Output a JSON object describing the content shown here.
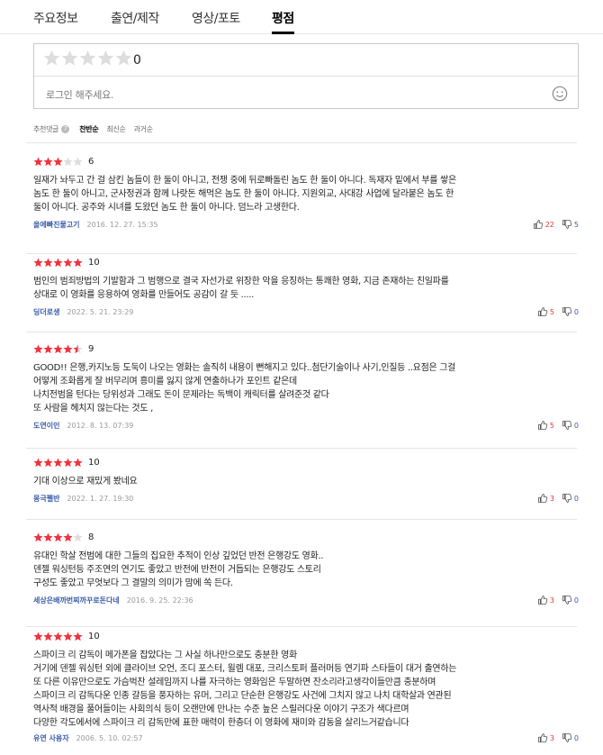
{
  "tabs": [
    {
      "label": "주요정보"
    },
    {
      "label": "출연/제작"
    },
    {
      "label": "영상/포토"
    },
    {
      "label": "평점"
    }
  ],
  "rating_box": {
    "score": "0",
    "placeholder": "로그인 해주세요."
  },
  "sort": {
    "label": "추천댓글",
    "help_icon": "?",
    "options": [
      "찬반순",
      "최신순",
      "과거순"
    ]
  },
  "reviews": [
    {
      "rating": 6,
      "text": "일재가 놔두고 간 걸 삼킨 놈들이 한 둘이 아니고, 전쟁 중에 뒤로빠돌린 놈도 한 둘이 아니다. 독재자 밑에서 부를 쌓은\n놈도 한 둘이 아니고, 군사정권과 함께 나랏돈 해먹은 놈도 한 둘이 아니다. 지원외교, 사대강 사업에 달라붙은 놈도 한\n둘이 아니다. 공주와 시녀를 도왔던 놈도 한 둘이 아니다. 덤느라 고생한다.",
      "author": "올에빠진물고기",
      "date": "2016. 12. 27. 15:35",
      "likes": "22",
      "dislikes": "5"
    },
    {
      "rating": 10,
      "text": "범인의 범죄방법의 기발함과 그 범행으로 결국 자선가로 위장한 악을 응징하는 통쾌한 영화,  지금 존재하는 친일파를\n상대로 이 영화를 응용하여 영화를 만들어도 공감이 갈 듯 .....",
      "author": "딩더로생",
      "date": "2022. 5. 21. 23:29",
      "likes": "5",
      "dislikes": "0"
    },
    {
      "rating": 9,
      "text": "GOOD!! 은행,카지노등 도둑이 나오는 영화는 솔직히 내용이 뻔해지고 있다..첨단기술이나 사기,인질등 ..요점은 그걸\n어떻게 조화롭게 잘 버무리며 흥미를 잃지 않게 연출하나가 포인트 같은데\n나치전범을 턴다는 당위성과 그래도 돈이 문제라는 독백이 캐릭터를 살려준것 같다\n또 사람을 헤치지 않는다는 것도 ,",
      "author": "도연이인",
      "date": "2012. 8. 13. 07:39",
      "likes": "5",
      "dislikes": "0"
    },
    {
      "rating": 10,
      "text": "기대 이상으로 재밌게 봤네요",
      "author": "몽극펠반",
      "date": "2022. 1. 27. 19:30",
      "likes": "3",
      "dislikes": "0"
    },
    {
      "rating": 8,
      "text": "유대인 학살 전범에 대한 그들의 집요한 추적이 인상 깊었던 반전 은행강도 영화..\n덴젤 워싱턴등 주조연의 연기도 좋았고 반전에 반전이 거듭되는 은행강도 스토리\n구성도 좋았고 무엇보다 그 결말의 의미가 맘에 쏙 든다.",
      "author": "세상은배까번찌까꾸로돈다네",
      "date": "2016. 9. 25. 22:36",
      "likes": "3",
      "dislikes": "0"
    },
    {
      "rating": 10,
      "text": "스파이크 리 감독이 메가폰을 잡았다는 그 사실 하나만으로도 충분한 영화\n거기에 덴젤 워싱턴 외에 클라이브 오언, 조디 포스터, 윌렘 대포, 크리스토퍼 플러머등 연기파 스타들이 대거 출연하는\n또 다른 이유만으로도 가슴벅찬 설레임까지 나를 자극하는 영화임은 두말하면 잔소리라고생각이들만큼 충분하며\n스파이크 리 감독다운 인종 갈등을 풍자하는 유머, 그리고 단순한 은행강도 사건에 그치지 않고 나치 대학살과 연관된\n역사적 배경을 풀어들이는 사회의식 등이 오랜만에 만나는 수준 높은 스릴러다운 이야기 구조가 색다르며\n다양한 각도에서에 스파이크 리 감독만에 표한 매력이 한층더 이 영화에 재미와 감동을 살리느거같습니다",
      "author": "유연 사용자",
      "date": "2006. 5. 10. 02:57",
      "likes": "3",
      "dislikes": "0"
    }
  ],
  "colors": {
    "star_filled": "#f0323c",
    "star_empty": "#dddddd",
    "author": "#3a5da8",
    "like": "#e0383e",
    "dislike": "#3a5da8"
  },
  "icons": {
    "empty_star": "empty-star-icon",
    "smile": "smile-icon",
    "thumb_up": "thumb-up-icon",
    "thumb_down": "thumb-down-icon"
  }
}
